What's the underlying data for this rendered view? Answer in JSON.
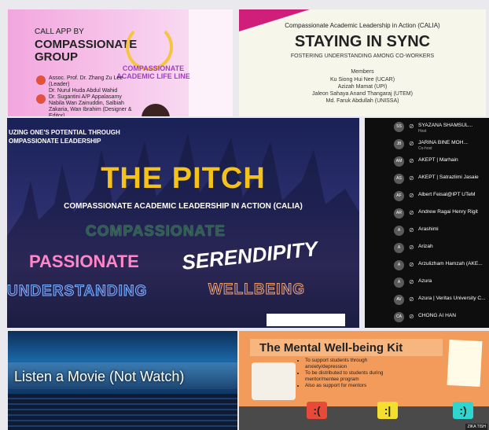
{
  "tile_top_left": {
    "small": "CALL APP BY",
    "title": "COMPASSIONATE GROUP",
    "logo_text": "COMPASSIONATE ACADEMIC LIFE LINE",
    "people": [
      {
        "name": "Assoc. Prof. Dr. Zhang Zu Lee (Leader)",
        "sub": "Dr. Nurul Huda Abdul Wahid"
      },
      {
        "name": "Dr. Sugantini A/P Appalasamy",
        "sub": "Nabila Wan Zainuddin, Salbiah Zakaria, Wan Ibrahim (Designer & Editor)"
      }
    ]
  },
  "tile_top_right": {
    "kicker": "Compassionate Academic Leadership in Action (CALIA)",
    "title": "STAYING IN SYNC",
    "subtitle": "FOSTERING UNDERSTANDING AMONG CO-WORKERS",
    "members_label": "Members",
    "members": [
      "Ku Siong Hui Nee (UCAR)",
      "Azizah Mamat (UPI)",
      "Jaleon Sahaya Anand Thangaraj (UTEM)",
      "Md. Faruk Abdullah (UNISSA)"
    ]
  },
  "tile_pitch": {
    "header_line1": "UZING ONE'S POTENTIAL THROUGH",
    "header_line2": "OMPASSIONATE LEADERSHIP",
    "title": "THE PITCH",
    "calia": "COMPASSIONATE ACADEMIC LEADERSHIP IN ACTION (CALIA)",
    "words": {
      "compassionate": "COMPASSIONATE",
      "passionate": "PASSIONATE",
      "serendipity": "SERENDIPITY",
      "understanding": "UNDERSTANDING",
      "wellbeing": "WELLBEING"
    }
  },
  "participants": [
    {
      "initials": "SS",
      "name": "SYAZANA SHAMSUL...",
      "sub": "Host"
    },
    {
      "initials": "JB",
      "name": "JARINA BINE MOH...",
      "sub": "Co-host"
    },
    {
      "initials": "AM",
      "name": "AKEPT | Marhain",
      "sub": ""
    },
    {
      "initials": "AS",
      "name": "AKEPT | Satrazlimi Jasaie",
      "sub": ""
    },
    {
      "initials": "AF",
      "name": "Albert Feisal@IPT UTeM",
      "sub": ""
    },
    {
      "initials": "AR",
      "name": "Andrew Ragai Henry Rigit",
      "sub": ""
    },
    {
      "initials": "A",
      "name": "Arashimi",
      "sub": ""
    },
    {
      "initials": "A",
      "name": "Arizah",
      "sub": ""
    },
    {
      "initials": "A",
      "name": "Arzulizham Hamzah (AKE...",
      "sub": ""
    },
    {
      "initials": "A",
      "name": "Azura",
      "sub": ""
    },
    {
      "initials": "AV",
      "name": "Azura | Veritas University C...",
      "sub": ""
    },
    {
      "initials": "CA",
      "name": "CHONG AI HAN",
      "sub": ""
    }
  ],
  "tile_movie": {
    "caption": "Listen a Movie (Not Watch)"
  },
  "tile_kit": {
    "title": "The Mental Well-being Kit",
    "bullets": [
      "To support students through anxiety/depression",
      "To be distributed to students during mentor/mentee program",
      "Also as support for mentors"
    ],
    "tag": "ZIKA TISH"
  },
  "colors": {
    "pitch_yellow": "#f5c21a",
    "passionate_pink": "#ff86c8",
    "panel_black": "#0e0e0e",
    "kit_orange": "#f39b5a"
  }
}
